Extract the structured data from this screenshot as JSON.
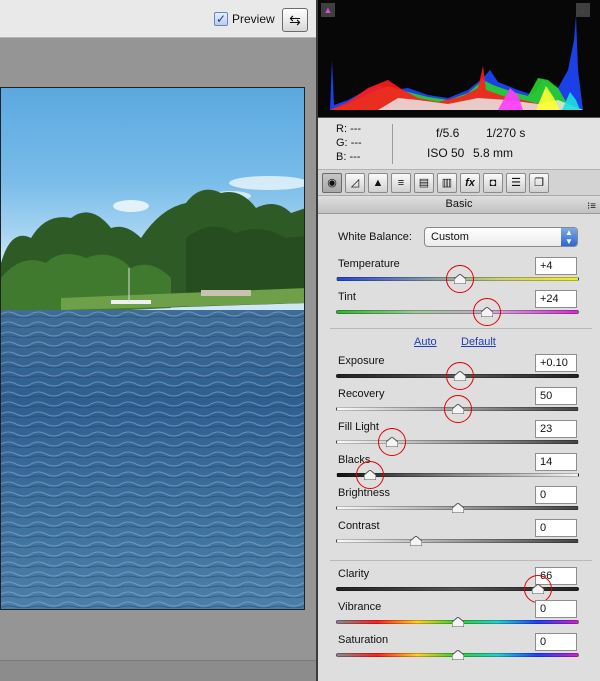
{
  "preview": {
    "label": "Preview",
    "checked": true
  },
  "rgb_readout": [
    {
      "label": "R:",
      "value": "---"
    },
    {
      "label": "G:",
      "value": "---"
    },
    {
      "label": "B:",
      "value": "---"
    }
  ],
  "exif": {
    "aperture": "f/5.6",
    "shutter": "1/270 s",
    "iso": "ISO 50",
    "focal_length": "5.8 mm"
  },
  "tabs": [
    {
      "name": "basic",
      "icon": "aperture-icon"
    },
    {
      "name": "tone-curve",
      "icon": "tone-curve-icon"
    },
    {
      "name": "detail",
      "icon": "detail-icon"
    },
    {
      "name": "hsl",
      "icon": "hsl-icon"
    },
    {
      "name": "split-toning",
      "icon": "split-toning-icon"
    },
    {
      "name": "lens-corrections",
      "icon": "lens-icon"
    },
    {
      "name": "effects",
      "icon": "fx-icon",
      "glyph": "fx"
    },
    {
      "name": "camera-calibration",
      "icon": "camera-icon"
    },
    {
      "name": "presets",
      "icon": "presets-icon"
    },
    {
      "name": "snapshots",
      "icon": "snapshots-icon"
    }
  ],
  "panel": {
    "title": "Basic",
    "white_balance_label": "White Balance:",
    "white_balance_value": "Custom",
    "auto_label": "Auto",
    "default_label": "Default"
  },
  "sliders": [
    {
      "id": "temperature",
      "label": "Temperature",
      "value": "+4",
      "position": 0.51,
      "track": "temperature",
      "highlighted": true
    },
    {
      "id": "tint",
      "label": "Tint",
      "value": "+24",
      "position": 0.62,
      "track": "tint",
      "highlighted": true
    },
    {
      "id": "exposure",
      "label": "Exposure",
      "value": "+0.10",
      "position": 0.51,
      "track": "dark",
      "highlighted": true
    },
    {
      "id": "recovery",
      "label": "Recovery",
      "value": "50",
      "position": 0.5,
      "track": "dark-to-light",
      "highlighted": true
    },
    {
      "id": "fill-light",
      "label": "Fill Light",
      "value": "23",
      "position": 0.23,
      "track": "dark-to-light",
      "highlighted": true
    },
    {
      "id": "blacks",
      "label": "Blacks",
      "value": "14",
      "position": 0.14,
      "track": "light-to-dark",
      "highlighted": true
    },
    {
      "id": "brightness",
      "label": "Brightness",
      "value": "0",
      "position": 0.5,
      "track": "dark-to-light",
      "highlighted": false
    },
    {
      "id": "contrast",
      "label": "Contrast",
      "value": "0",
      "position": 0.33,
      "track": "dark-to-light",
      "highlighted": false
    },
    {
      "id": "clarity",
      "label": "Clarity",
      "value": "66",
      "position": 0.83,
      "track": "dark",
      "highlighted": true
    },
    {
      "id": "vibrance",
      "label": "Vibrance",
      "value": "0",
      "position": 0.5,
      "track": "spectrum",
      "highlighted": false
    },
    {
      "id": "saturation",
      "label": "Saturation",
      "value": "0",
      "position": 0.5,
      "track": "spectrum",
      "highlighted": false
    }
  ],
  "colors": {
    "highlight_circle": "#e00000",
    "link": "#1f3fb5",
    "select_arrow": "#2c66cf"
  }
}
